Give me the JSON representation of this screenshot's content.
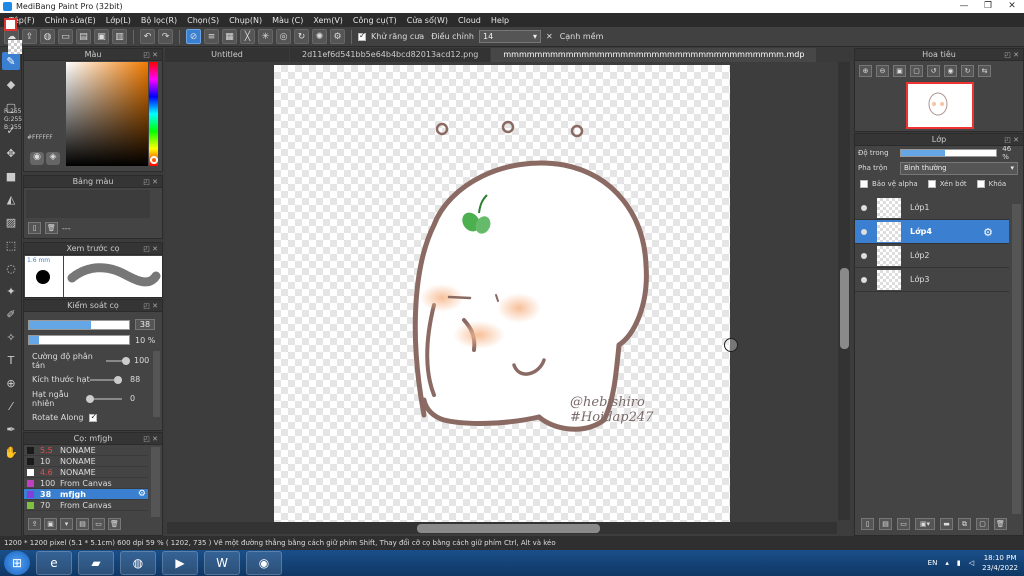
{
  "window": {
    "title": "MediBang Paint Pro (32bit)",
    "controls": [
      "—",
      "❐",
      "✕"
    ]
  },
  "menu": [
    "Tệp(F)",
    "Chỉnh sửa(E)",
    "Lớp(L)",
    "Bộ lọc(R)",
    "Chọn(S)",
    "Chụp(N)",
    "Màu (C)",
    "Xem(V)",
    "Công cụ(T)",
    "Cửa sổ(W)",
    "Cloud",
    "Help"
  ],
  "toolbar": {
    "antialias_label": "Khử răng cưa",
    "adjust_label": "Điều chỉnh",
    "adjust_value": "14",
    "close_label": "✕",
    "edge_label": "Cạnh mềm"
  },
  "color_panel": {
    "title": "Màu",
    "r": "R:255",
    "g": "G:255",
    "b": "B:255",
    "hex": "#FFFFFF"
  },
  "palette": {
    "title": "Bảng màu",
    "value": "---"
  },
  "brush_preview": {
    "title": "Xem trước cọ",
    "size": "1.6 mm"
  },
  "brush_control": {
    "title": "Kiểm soát cọ",
    "size_value": "38",
    "size_fraction": 0.62,
    "opacity_value": "10 %",
    "opacity_fraction": 0.1,
    "rows": [
      {
        "label": "Cường độ phân tán",
        "value": "100",
        "fraction": 1.0
      },
      {
        "label": "Kích thước hạt",
        "value": "88",
        "fraction": 0.88
      },
      {
        "label": "Hạt ngẫu nhiên",
        "value": "0",
        "fraction": 0.0
      },
      {
        "label": "Rotate Along",
        "value": ""
      }
    ]
  },
  "brush_list": {
    "title": "Cọ: mfjgh",
    "items": [
      {
        "num": "5.5",
        "name": "NONAME",
        "color": "#1a1a1a",
        "num_color": "#e05050"
      },
      {
        "num": "10",
        "name": "NONAME",
        "color": "#1a1a1a",
        "num_color": "#dddddd"
      },
      {
        "num": "4.6",
        "name": "NONAME",
        "color": "#ffffff",
        "num_color": "#e05050"
      },
      {
        "num": "100",
        "name": "From Canvas",
        "color": "#c040c0",
        "num_color": "#dddddd"
      },
      {
        "num": "38",
        "name": "mfjgh",
        "color": "#8040e0",
        "num_color": "#ffffff",
        "selected": true
      },
      {
        "num": "70",
        "name": "From Canvas",
        "color": "#80c040",
        "num_color": "#dddddd"
      }
    ]
  },
  "tabs": [
    {
      "label": "Untitled",
      "active": false
    },
    {
      "label": "2d11ef6d541bb5e64b4bcd82013acd12.png",
      "active": false
    },
    {
      "label": "mmmmmmmmmmmmmmmmmmmmmmmmmmmmmmmmmmmm.mdp",
      "active": true
    }
  ],
  "artwork": {
    "signature_1": "@hebishiro",
    "signature_2": "#Hoidap247"
  },
  "navigator": {
    "title": "Hoa tiêu"
  },
  "layers_panel": {
    "title": "Lớp",
    "opacity_label": "Độ trong",
    "opacity_value": "46 %",
    "opacity_fraction": 0.46,
    "blend_label": "Pha trộn",
    "blend_value": "Bình thường",
    "protect_alpha": "Bảo vệ alpha",
    "clipping": "Xén bớt",
    "lock": "Khóa",
    "layers": [
      {
        "name": "Lớp1",
        "selected": false
      },
      {
        "name": "Lớp4",
        "selected": true
      },
      {
        "name": "Lớp2",
        "selected": false
      },
      {
        "name": "Lớp3",
        "selected": false
      }
    ]
  },
  "status": "1200 * 1200 pixel   (5.1 * 5.1cm)   600 dpi   59 %   ( 1202, 735 )   Vẽ một đường thẳng bằng cách giữ phím Shift, Thay đổi cỡ cọ bằng cách giữ phím Ctrl, Alt và kéo",
  "taskbar": {
    "lang": "EN",
    "time": "18:10 PM",
    "date": "23/4/2022"
  }
}
